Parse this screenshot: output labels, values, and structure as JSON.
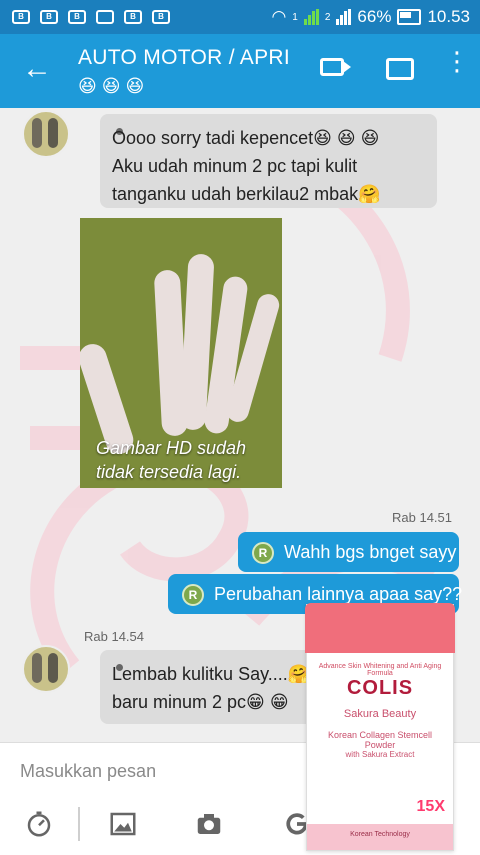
{
  "status": {
    "battery": "66%",
    "time": "10.53",
    "signal_labels": [
      "1",
      "2"
    ]
  },
  "header": {
    "title": "AUTO MOTOR / APRI",
    "subtitle": "😆 😆 😆"
  },
  "messages": {
    "incoming1": {
      "line1": "Oooo sorry tadi kepencet😆 😆 😆",
      "line2": "Aku udah minum 2 pc tapi kulit",
      "line3": "tanganku udah berkilau2 mbak🤗"
    },
    "photo": {
      "caption_line1": "Gambar HD sudah",
      "caption_line2": "tidak tersedia lagi."
    },
    "outgoing_time": "Rab 14.51",
    "outgoing1": "Wahh bgs bnget sayy",
    "outgoing2": "Perubahan lainnya apaa say??",
    "incoming_time": "Rab 14.54",
    "incoming2": {
      "line1": "Lembab kulitku Say....🤗",
      "line2": "baru minum 2 pc😁 😁"
    },
    "avatar_initial": "R"
  },
  "input": {
    "placeholder": "Masukkan pesan"
  },
  "product": {
    "brand": "COLIS",
    "line": "Sakura Beauty",
    "desc1": "Advance Skin Whitening and Anti Aging Formula",
    "desc2": "Korean Collagen Stemcell Powder",
    "desc3": "with Sakura Extract",
    "badge": "15X",
    "footer": "Korean Technology"
  },
  "icons": [
    "back-arrow-icon",
    "video-call-icon",
    "mask-icon",
    "more-icon",
    "timer-icon",
    "image-icon",
    "camera-icon",
    "google-icon",
    "chevron-right-icon"
  ]
}
